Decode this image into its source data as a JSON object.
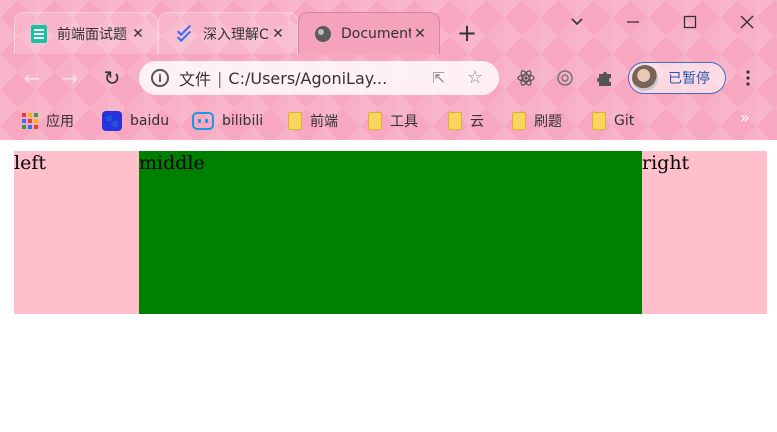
{
  "browser": {
    "tabs": [
      {
        "title": "前端面试题",
        "icon": "document-icon",
        "active": false
      },
      {
        "title": "深入理解CSS",
        "icon": "stack-icon",
        "active": false
      },
      {
        "title": "Document",
        "icon": "globe-icon",
        "active": true
      }
    ],
    "new_tab_label": "+",
    "window_controls": {
      "dropdown": "⌄",
      "minimize": "—",
      "maximize": "☐",
      "close": "✕"
    },
    "nav": {
      "back": "←",
      "forward": "→",
      "reload": "↻"
    },
    "address": {
      "info_glyph": "i",
      "label": "文件",
      "separator": "|",
      "url": "C:/Users/AgoniLay..."
    },
    "profile_label": "已暂停",
    "bookmarks": [
      {
        "label": "应用",
        "icon": "apps-grid-icon"
      },
      {
        "label": "baidu",
        "icon": "baidu-icon"
      },
      {
        "label": "bilibili",
        "icon": "bilibili-icon"
      },
      {
        "label": "前端",
        "icon": "folder-icon"
      },
      {
        "label": "工具",
        "icon": "folder-icon"
      },
      {
        "label": "云",
        "icon": "folder-icon"
      },
      {
        "label": "刷题",
        "icon": "folder-icon"
      },
      {
        "label": "Git",
        "icon": "folder-icon"
      }
    ],
    "bookmarks_overflow": "»",
    "theme_color": "#f7a7bf"
  },
  "page": {
    "columns": [
      {
        "label": "left",
        "color": "#ffc0cb"
      },
      {
        "label": "middle",
        "color": "#008000"
      },
      {
        "label": "right",
        "color": "#ffc0cb"
      }
    ]
  }
}
